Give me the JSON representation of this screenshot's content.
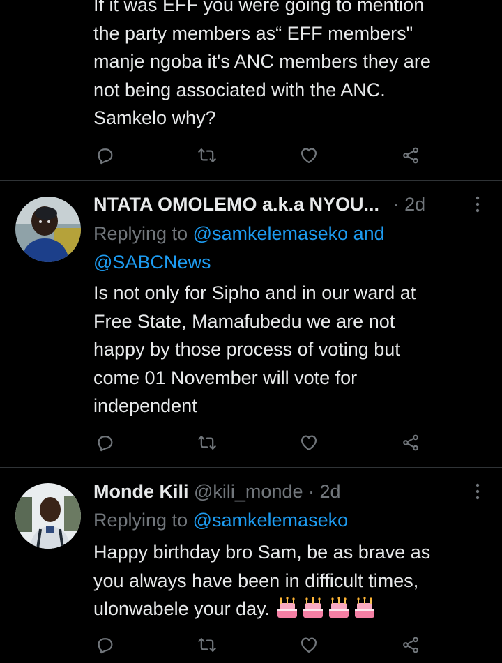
{
  "colors": {
    "background": "#000000",
    "text": "#e7e9ea",
    "secondary": "#71767b",
    "link": "#1d9bf0",
    "divider": "#2f3336"
  },
  "tweet1": {
    "text": "If it was EFF you were going to mention\nthe party members as“ EFF members\"\nmanje ngoba it's ANC members they are\nnot being associated with the ANC.\nSamkelo why?"
  },
  "tweet2": {
    "name": "NTATA OMOLEMO a.k.a NYOU...",
    "separator": "·",
    "time": "2d",
    "replying_prefix": "Replying to",
    "mention1": "@samkelemaseko",
    "and": "and",
    "mention2": "@SABCNews",
    "text": "Is not only for Sipho and in our ward at\nFree State, Mamafubedu we are not\nhappy by those process of voting but\ncome 01 November will vote for\nindependent"
  },
  "tweet3": {
    "name": "Monde Kili",
    "handle": "@kili_monde",
    "separator": "·",
    "time": "2d",
    "replying_prefix": "Replying to",
    "mention1": "@samkelemaseko",
    "text": "Happy birthday bro Sam, be as brave as\nyou always have been in difficult times,\nulonwabele your day.",
    "emojis": [
      "birthday-cake-icon",
      "birthday-cake-icon",
      "birthday-cake-icon",
      "birthday-cake-icon"
    ]
  },
  "icons": {
    "reply": "reply-icon",
    "retweet": "retweet-icon",
    "like": "heart-icon",
    "share": "share-icon",
    "more": "more-vertical-icon"
  }
}
